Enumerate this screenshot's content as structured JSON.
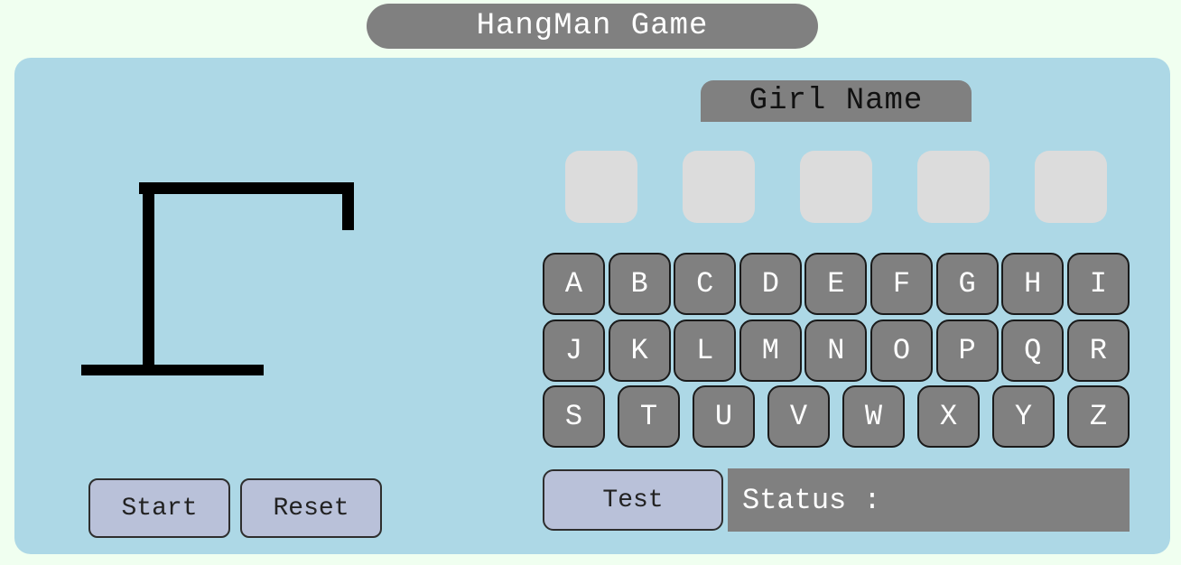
{
  "title": "HangMan Game",
  "category": "Girl Name",
  "word_slots": [
    "",
    "",
    "",
    "",
    ""
  ],
  "keyboard": {
    "row1": [
      "A",
      "B",
      "C",
      "D",
      "E",
      "F",
      "G",
      "H",
      "I"
    ],
    "row2": [
      "J",
      "K",
      "L",
      "M",
      "N",
      "O",
      "P",
      "Q",
      "R"
    ],
    "row3": [
      "S",
      "T",
      "U",
      "V",
      "W",
      "X",
      "Y",
      "Z"
    ]
  },
  "controls": {
    "start_label": "Start",
    "reset_label": "Reset",
    "test_label": "Test"
  },
  "status": {
    "label": "Status :"
  },
  "colors": {
    "page_background": "#f0fff0",
    "panel_background": "#add8e6",
    "key_background": "#808080",
    "button_background": "#b9c1d9",
    "slot_background": "#dcdcdc"
  }
}
